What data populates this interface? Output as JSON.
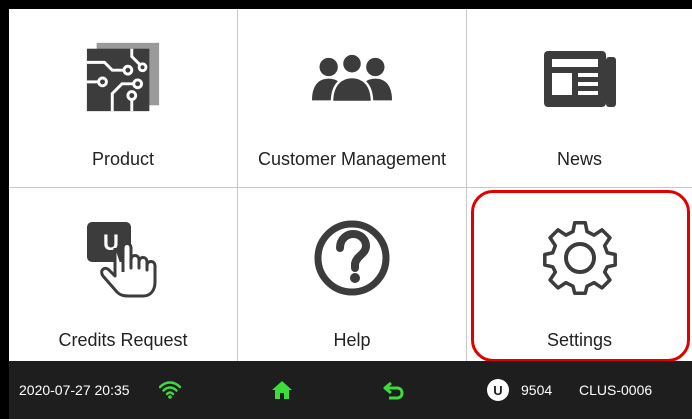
{
  "tiles": {
    "product": {
      "label": "Product",
      "icon": "circuit-board-icon"
    },
    "customer_management": {
      "label": "Customer Management",
      "icon": "users-group-icon"
    },
    "news": {
      "label": "News",
      "icon": "newspaper-icon"
    },
    "credits_request": {
      "label": "Credits Request",
      "icon": "hand-tap-u-icon"
    },
    "help": {
      "label": "Help",
      "icon": "question-circle-icon"
    },
    "settings": {
      "label": "Settings",
      "icon": "gear-icon"
    }
  },
  "statusbar": {
    "datetime": "2020-07-27 20:35",
    "wifi_icon": "wifi-icon",
    "home_icon": "home-icon",
    "back_icon": "back-arrow-icon",
    "credits_badge": "U",
    "credits_value": "9504",
    "device_id": "CLUS-0006"
  },
  "colors": {
    "icon_gray": "#3c3c3c",
    "accent_green": "#3ddc3d",
    "highlight_red": "#e00000",
    "statusbar_bg": "#1e1e1e"
  }
}
